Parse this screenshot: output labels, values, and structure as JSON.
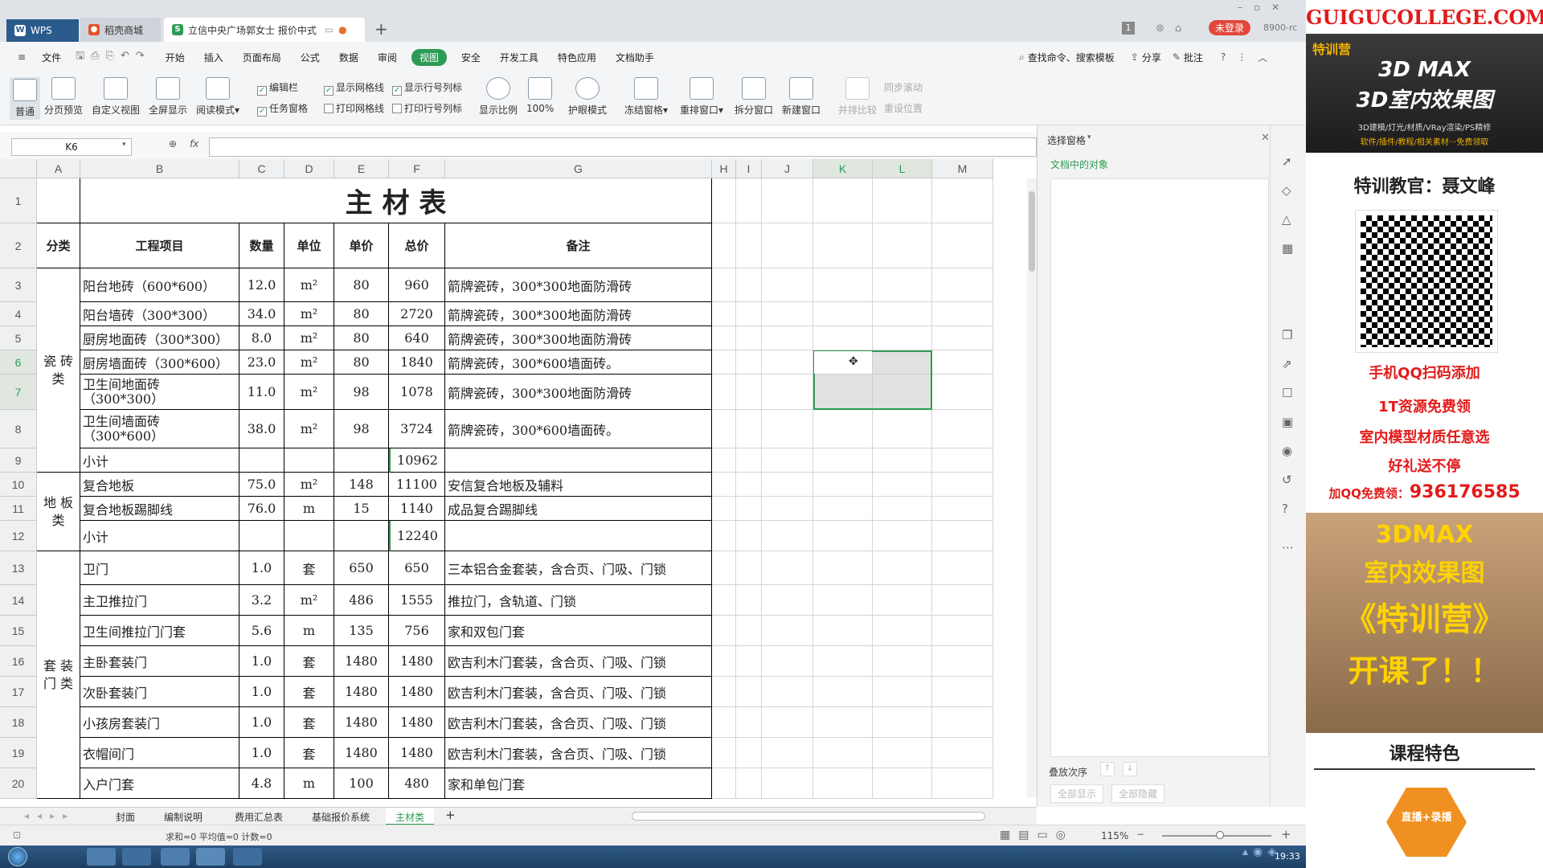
{
  "app": {
    "name": "WPS"
  },
  "tabs": [
    {
      "label": "WPS"
    },
    {
      "label": "稻壳商城"
    },
    {
      "label": "立信中央广场郭女士 报价中式"
    }
  ],
  "titlebar": {
    "login_badge": "未登录",
    "user_code": "8900-rc",
    "page_count": "1"
  },
  "menu": [
    "文件",
    "开始",
    "插入",
    "页面布局",
    "公式",
    "数据",
    "审阅",
    "视图",
    "安全",
    "开发工具",
    "特色应用",
    "文档助手"
  ],
  "menu_active": "视图",
  "menu_right": {
    "search": "查找命令、搜索模板",
    "share": "分享",
    "annotate": "批注"
  },
  "ribbon": {
    "buttons": [
      "普通",
      "分页预览",
      "自定义视图",
      "全屏显示",
      "阅读模式",
      "显示比例",
      "100%",
      "护眼模式",
      "冻结窗格",
      "重排窗口",
      "拆分窗口",
      "新建窗口",
      "并排比较",
      "同步滚动",
      "重设位置"
    ],
    "checks": [
      {
        "label": "编辑栏",
        "checked": true
      },
      {
        "label": "任务窗格",
        "checked": true
      },
      {
        "label": "显示网格线",
        "checked": true
      },
      {
        "label": "打印网格线",
        "checked": false
      },
      {
        "label": "显示行号列标",
        "checked": true
      },
      {
        "label": "打印行号列标",
        "checked": false
      }
    ]
  },
  "formula_bar": {
    "name_box": "K6",
    "fx": "fx",
    "value": ""
  },
  "columns": [
    "A",
    "B",
    "C",
    "D",
    "E",
    "F",
    "G",
    "H",
    "I",
    "J",
    "K",
    "L",
    "M"
  ],
  "sheet": {
    "title": "主    材    表",
    "headers": [
      "分类",
      "工程项目",
      "数量",
      "单位",
      "单价",
      "总价",
      "备注"
    ],
    "categories": [
      {
        "label": "瓷 砖 类",
        "rows": [
          3,
          9
        ]
      },
      {
        "label": "地 板 类",
        "rows": [
          10,
          12
        ]
      },
      {
        "label": "套 装 门 类",
        "rows": [
          13,
          20
        ]
      }
    ],
    "rows": [
      {
        "num": "3",
        "item": "阳台地砖（600*600）",
        "qty": "12.0",
        "unit": "m²",
        "price": "80",
        "total": "960",
        "note": "箭牌瓷砖，300*300地面防滑砖"
      },
      {
        "num": "4",
        "item": "阳台墙砖（300*300）",
        "qty": "34.0",
        "unit": "m²",
        "price": "80",
        "total": "2720",
        "note": "箭牌瓷砖，300*300地面防滑砖"
      },
      {
        "num": "5",
        "item": "厨房地面砖（300*300）",
        "qty": "8.0",
        "unit": "m²",
        "price": "80",
        "total": "640",
        "note": "箭牌瓷砖，300*300地面防滑砖"
      },
      {
        "num": "6",
        "item": "厨房墙面砖（300*600）",
        "qty": "23.0",
        "unit": "m²",
        "price": "80",
        "total": "1840",
        "note": "箭牌瓷砖，300*600墙面砖。"
      },
      {
        "num": "7",
        "item": "卫生间地面砖",
        "item2": "（300*300）",
        "qty": "11.0",
        "unit": "m²",
        "price": "98",
        "total": "1078",
        "note": "箭牌瓷砖，300*300地面防滑砖"
      },
      {
        "num": "8",
        "item": "卫生间墙面砖",
        "item2": "（300*600）",
        "qty": "38.0",
        "unit": "m²",
        "price": "98",
        "total": "3724",
        "note": "箭牌瓷砖，300*600墙面砖。"
      },
      {
        "num": "9",
        "item": "小计",
        "qty": "",
        "unit": "",
        "price": "",
        "total": "10962",
        "note": ""
      },
      {
        "num": "10",
        "item": "复合地板",
        "qty": "75.0",
        "unit": "m²",
        "price": "148",
        "total": "11100",
        "note": "安信复合地板及辅料"
      },
      {
        "num": "11",
        "item": "复合地板踢脚线",
        "qty": "76.0",
        "unit": "m",
        "price": "15",
        "total": "1140",
        "note": "成品复合踢脚线"
      },
      {
        "num": "12",
        "item": "小计",
        "qty": "",
        "unit": "",
        "price": "",
        "total": "12240",
        "note": ""
      },
      {
        "num": "13",
        "item": "卫门",
        "qty": "1.0",
        "unit": "套",
        "price": "650",
        "total": "650",
        "note": "三本铝合金套装，含合页、门吸、门锁"
      },
      {
        "num": "14",
        "item": "主卫推拉门",
        "qty": "3.2",
        "unit": "m²",
        "price": "486",
        "total": "1555",
        "note": "推拉门，含轨道、门锁"
      },
      {
        "num": "15",
        "item": "卫生间推拉门门套",
        "qty": "5.6",
        "unit": "m",
        "price": "135",
        "total": "756",
        "note": "家和双包门套"
      },
      {
        "num": "16",
        "item": "主卧套装门",
        "qty": "1.0",
        "unit": "套",
        "price": "1480",
        "total": "1480",
        "note": "欧吉利木门套装，含合页、门吸、门锁"
      },
      {
        "num": "17",
        "item": "次卧套装门",
        "qty": "1.0",
        "unit": "套",
        "price": "1480",
        "total": "1480",
        "note": "欧吉利木门套装，含合页、门吸、门锁"
      },
      {
        "num": "18",
        "item": "小孩房套装门",
        "qty": "1.0",
        "unit": "套",
        "price": "1480",
        "total": "1480",
        "note": "欧吉利木门套装，含合页、门吸、门锁"
      },
      {
        "num": "19",
        "item": "衣帽间门",
        "qty": "1.0",
        "unit": "套",
        "price": "1480",
        "total": "1480",
        "note": "欧吉利木门套装，含合页、门吸、门锁"
      },
      {
        "num": "20",
        "item": "入户门套",
        "qty": "4.8",
        "unit": "m",
        "price": "100",
        "total": "480",
        "note": "家和单包门套"
      }
    ]
  },
  "selection_pane": {
    "title": "选择窗格",
    "subtitle": "文档中的对象",
    "order_label": "叠放次序",
    "show_all": "全部显示",
    "hide_all": "全部隐藏"
  },
  "sheet_tabs": [
    "封面",
    "编制说明",
    "费用汇总表",
    "基础报价系统",
    "主材类"
  ],
  "active_sheet": "主材类",
  "status": {
    "summary": "求和=0   平均值=0   计数=0",
    "zoom": "115%"
  },
  "taskbar": {
    "clock": "19:33"
  },
  "ad": {
    "header": "GUIGUCOLLEGE.COM",
    "banner_badge": "特训营",
    "banner_title": "3D MAX",
    "banner_sub": "3D室内效果图",
    "banner_line": "3D建模/灯光/材质/VRay渲染/PS精修",
    "banner_line2": "软件/插件/教程/相关素材···免费领取",
    "teacher": "特训教官：聂文峰",
    "qr_caption": "手机QQ扫码添加",
    "promo1": "1T资源免费领",
    "promo2": "室内模型材质任意选",
    "promo3": "好礼送不停",
    "qq_label": "加QQ免费领：",
    "qq_number": "936176585",
    "poster1": "3DMAX",
    "poster2": "室内效果图",
    "poster3": "《特训营》",
    "poster4": "开课了！！",
    "features": "课程特色",
    "live": "直播+录播"
  }
}
